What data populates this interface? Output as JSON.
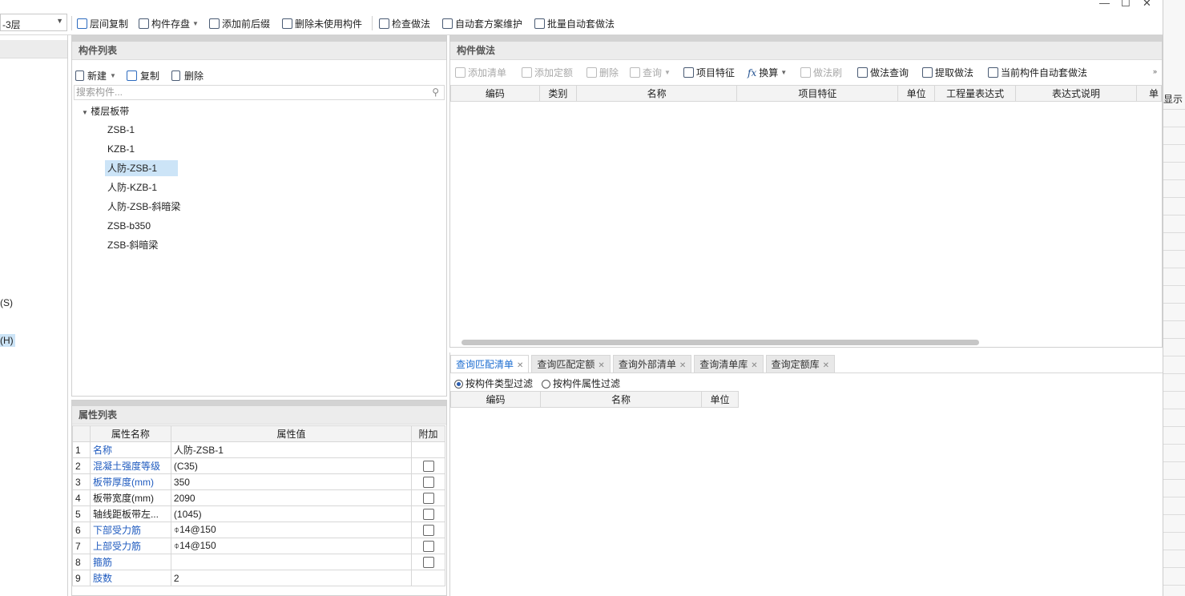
{
  "window": {
    "minimize": "—",
    "maximize": "☐",
    "close": "✕"
  },
  "floor_selector": {
    "value": "-3层"
  },
  "toolbar": {
    "floor_copy": "层间复制",
    "component_save": "构件存盘",
    "add_prefix_suffix": "添加前后缀",
    "delete_unused": "删除未使用构件",
    "check_method": "检查做法",
    "auto_scheme_maintain": "自动套方案维护",
    "batch_auto_method": "批量自动套做法"
  },
  "left_edge": {
    "label_s": "(S)",
    "label_h": "(H)"
  },
  "component_list": {
    "title": "构件列表",
    "new_label": "新建",
    "copy_label": "复制",
    "delete_label": "删除",
    "search_placeholder": "搜索构件...",
    "root": "楼层板带",
    "items": [
      "ZSB-1",
      "KZB-1",
      "人防-ZSB-1",
      "人防-KZB-1",
      "人防-ZSB-斜暗梁",
      "ZSB-b350",
      "ZSB-斜暗梁"
    ],
    "selected": "人防-ZSB-1"
  },
  "property_list": {
    "title": "属性列表",
    "headers": {
      "name": "属性名称",
      "value": "属性值",
      "extra": "附加"
    },
    "rows": [
      {
        "n": "1",
        "name": "名称",
        "value": "人防-ZSB-1",
        "link": true,
        "check": false
      },
      {
        "n": "2",
        "name": "混凝土强度等级",
        "value": "(C35)",
        "link": true,
        "check": true
      },
      {
        "n": "3",
        "name": "板带厚度(mm)",
        "value": "350",
        "link": true,
        "check": true
      },
      {
        "n": "4",
        "name": "板带宽度(mm)",
        "value": "2090",
        "link": false,
        "check": true
      },
      {
        "n": "5",
        "name": "轴线距板带左...",
        "value": "(1045)",
        "link": false,
        "check": true
      },
      {
        "n": "6",
        "name": "下部受力筋",
        "value": "⌽14@150",
        "link": true,
        "check": true
      },
      {
        "n": "7",
        "name": "上部受力筋",
        "value": "⌽14@150",
        "link": true,
        "check": true
      },
      {
        "n": "8",
        "name": "箍筋",
        "value": "",
        "link": true,
        "check": true
      },
      {
        "n": "9",
        "name": "肢数",
        "value": "2",
        "link": true,
        "check": false
      }
    ]
  },
  "component_method": {
    "title": "构件做法",
    "toolbar": {
      "add_list": "添加清单",
      "add_quota": "添加定额",
      "delete": "删除",
      "query": "查询",
      "project_feature": "项目特征",
      "convert": "换算",
      "method_brush": "做法刷",
      "method_query": "做法查询",
      "extract_method": "提取做法",
      "current_auto_method": "当前构件自动套做法"
    },
    "headers": [
      "编码",
      "类别",
      "名称",
      "项目特征",
      "单位",
      "工程量表达式",
      "表达式说明",
      "单"
    ]
  },
  "query_panel": {
    "tabs": [
      "查询匹配清单",
      "查询匹配定额",
      "查询外部清单",
      "查询清单库",
      "查询定额库"
    ],
    "active_tab": "查询匹配清单",
    "filter_by_type": "按构件类型过滤",
    "filter_by_attr": "按构件属性过滤",
    "headers": [
      "编码",
      "名称",
      "单位"
    ]
  },
  "right_strip": {
    "label": "显示"
  },
  "colors": {
    "link": "#1f5bbf",
    "active_tab": "#1f6fd1",
    "selection": "#cce4f7"
  }
}
